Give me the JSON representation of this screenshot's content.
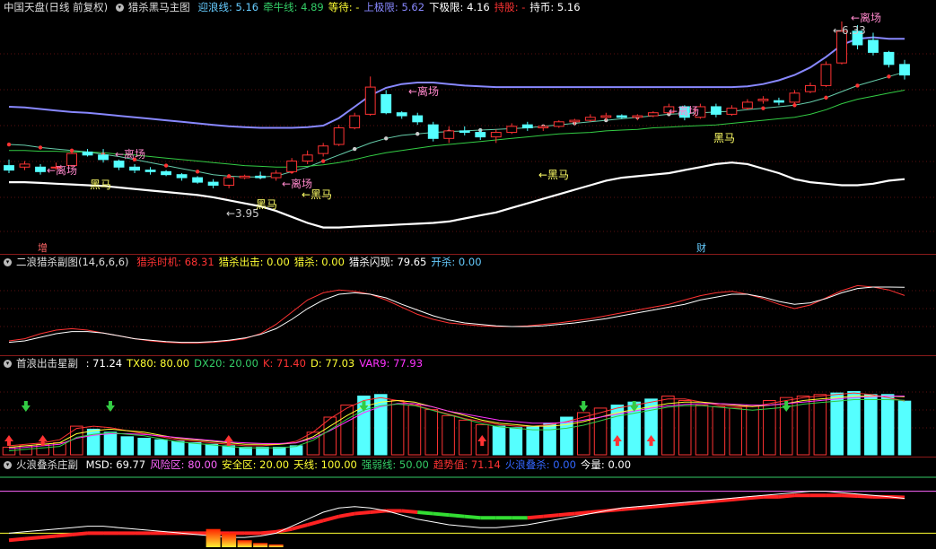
{
  "main_header": {
    "stock": "中国天盘",
    "mode": "(日线 前复权)",
    "indicator": "猎杀黑马主图",
    "items": [
      {
        "label": "迎浪线:",
        "value": "5.16",
        "color": "#66ccff"
      },
      {
        "label": "牵牛线:",
        "value": "4.89",
        "color": "#33cc66"
      },
      {
        "label": "等待:",
        "value": "-",
        "color": "#ffff33"
      },
      {
        "label": "上极限:",
        "value": "5.62",
        "color": "#8888ff"
      },
      {
        "label": "下极限:",
        "value": "4.16",
        "color": "#ffffff"
      },
      {
        "label": "持股:",
        "value": "-",
        "color": "#ff3333"
      },
      {
        "label": "持币:",
        "value": "5.16",
        "color": "#ffffff"
      }
    ]
  },
  "main_annotations": {
    "exit_label": "←离场",
    "dark_horse_label": "黑马",
    "dark_horse_arrow_label": "←黑马",
    "low_price_label": "←3.95",
    "high_price_label": "←6.33",
    "bottom_left_label": "增",
    "bottom_mid_label": "财"
  },
  "panel2_header": {
    "title": "二浪猎杀副图(14,6,6,6)",
    "items": [
      {
        "label": "猎杀时机:",
        "value": "68.31",
        "color": "#ff3333"
      },
      {
        "label": "猎杀出击:",
        "value": "0.00",
        "color": "#ffff33"
      },
      {
        "label": "猎杀:",
        "value": "0.00",
        "color": "#ffff33"
      },
      {
        "label": "猎杀闪现:",
        "value": "79.65",
        "color": "#ffffff"
      },
      {
        "label": "开杀:",
        "value": "0.00",
        "color": "#66ccff"
      }
    ]
  },
  "panel3_header": {
    "title": "首浪出击星副",
    "items": [
      {
        "label": ":",
        "value": "71.24",
        "color": "#ffffff"
      },
      {
        "label": "TX80:",
        "value": "80.00",
        "color": "#ffff33"
      },
      {
        "label": "DX20:",
        "value": "20.00",
        "color": "#33cc66"
      },
      {
        "label": "K:",
        "value": "71.40",
        "color": "#ff3333"
      },
      {
        "label": "D:",
        "value": "77.03",
        "color": "#ffff33"
      },
      {
        "label": "VAR9:",
        "value": "77.93",
        "color": "#ff33ff"
      }
    ]
  },
  "panel4_header": {
    "title": "火浪叠杀庄副",
    "items": [
      {
        "label": "MSD:",
        "value": "69.77",
        "color": "#ffffff"
      },
      {
        "label": "风险区:",
        "value": "80.00",
        "color": "#ff66ff"
      },
      {
        "label": "安全区:",
        "value": "20.00",
        "color": "#ffff33"
      },
      {
        "label": "天线:",
        "value": "100.00",
        "color": "#ffff33"
      },
      {
        "label": "强弱线:",
        "value": "50.00",
        "color": "#33cc66"
      },
      {
        "label": "趋势值:",
        "value": "71.14",
        "color": "#ff3333"
      },
      {
        "label": "火浪叠杀:",
        "value": "0.00",
        "color": "#3366ff"
      },
      {
        "label": "今量:",
        "value": "0.00",
        "color": "#ffffff"
      }
    ]
  },
  "chart_data": [
    {
      "type": "candlestick",
      "note_series": [
        "迎浪线",
        "牵牛线",
        "上极限",
        "下极限"
      ],
      "ohlc": [
        [
          4.42,
          4.5,
          4.32,
          4.36
        ],
        [
          4.4,
          4.48,
          4.36,
          4.44
        ],
        [
          4.4,
          4.44,
          4.3,
          4.34
        ],
        [
          4.4,
          4.46,
          4.36,
          4.4
        ],
        [
          4.42,
          4.62,
          4.4,
          4.58
        ],
        [
          4.6,
          4.64,
          4.54,
          4.56
        ],
        [
          4.56,
          4.64,
          4.46,
          4.5
        ],
        [
          4.48,
          4.5,
          4.36,
          4.4
        ],
        [
          4.4,
          4.44,
          4.32,
          4.36
        ],
        [
          4.36,
          4.4,
          4.3,
          4.34
        ],
        [
          4.34,
          4.36,
          4.28,
          4.3
        ],
        [
          4.3,
          4.32,
          4.22,
          4.26
        ],
        [
          4.26,
          4.28,
          4.18,
          4.2
        ],
        [
          4.2,
          4.24,
          4.12,
          4.16
        ],
        [
          4.16,
          4.3,
          4.12,
          4.26
        ],
        [
          4.26,
          4.3,
          4.24,
          4.28
        ],
        [
          4.28,
          4.34,
          4.24,
          4.26
        ],
        [
          4.26,
          4.36,
          4.22,
          4.32
        ],
        [
          4.34,
          4.52,
          4.32,
          4.48
        ],
        [
          4.48,
          4.62,
          4.44,
          4.56
        ],
        [
          4.58,
          4.72,
          4.54,
          4.68
        ],
        [
          4.7,
          4.96,
          4.68,
          4.92
        ],
        [
          4.92,
          5.12,
          4.9,
          5.08
        ],
        [
          5.1,
          5.6,
          5.08,
          5.46
        ],
        [
          5.36,
          5.42,
          5.1,
          5.12
        ],
        [
          5.12,
          5.14,
          5.04,
          5.08
        ],
        [
          5.08,
          5.12,
          4.96,
          5.0
        ],
        [
          4.96,
          5.0,
          4.74,
          4.78
        ],
        [
          4.78,
          4.94,
          4.72,
          4.88
        ],
        [
          4.88,
          4.94,
          4.82,
          4.86
        ],
        [
          4.86,
          4.9,
          4.76,
          4.8
        ],
        [
          4.8,
          4.9,
          4.72,
          4.86
        ],
        [
          4.86,
          4.98,
          4.84,
          4.94
        ],
        [
          4.96,
          5.0,
          4.88,
          4.92
        ],
        [
          4.92,
          4.96,
          4.88,
          4.94
        ],
        [
          4.94,
          5.02,
          4.92,
          5.0
        ],
        [
          5.0,
          5.04,
          4.96,
          5.02
        ],
        [
          5.02,
          5.1,
          5.0,
          5.06
        ],
        [
          5.06,
          5.12,
          5.02,
          5.08
        ],
        [
          5.08,
          5.1,
          5.04,
          5.06
        ],
        [
          5.06,
          5.1,
          5.02,
          5.08
        ],
        [
          5.08,
          5.14,
          5.06,
          5.12
        ],
        [
          5.12,
          5.24,
          5.1,
          5.2
        ],
        [
          5.2,
          5.22,
          5.02,
          5.06
        ],
        [
          5.06,
          5.24,
          5.04,
          5.2
        ],
        [
          5.2,
          5.24,
          5.06,
          5.1
        ],
        [
          5.1,
          5.22,
          5.08,
          5.18
        ],
        [
          5.18,
          5.3,
          5.16,
          5.26
        ],
        [
          5.28,
          5.34,
          5.24,
          5.3
        ],
        [
          5.28,
          5.32,
          5.22,
          5.26
        ],
        [
          5.26,
          5.42,
          5.24,
          5.38
        ],
        [
          5.4,
          5.52,
          5.38,
          5.48
        ],
        [
          5.48,
          5.8,
          5.46,
          5.76
        ],
        [
          5.78,
          6.33,
          5.76,
          6.2
        ],
        [
          6.2,
          6.28,
          5.96,
          6.02
        ],
        [
          6.08,
          6.18,
          5.88,
          5.92
        ],
        [
          5.92,
          5.94,
          5.72,
          5.76
        ],
        [
          5.76,
          5.82,
          5.56,
          5.62
        ]
      ],
      "lines": {
        "迎浪线": [
          4.7,
          4.69,
          4.66,
          4.64,
          4.62,
          4.6,
          4.57,
          4.54,
          4.5,
          4.46,
          4.42,
          4.38,
          4.34,
          4.3,
          4.28,
          4.27,
          4.27,
          4.28,
          4.34,
          4.4,
          4.48,
          4.56,
          4.64,
          4.72,
          4.78,
          4.82,
          4.84,
          4.86,
          4.87,
          4.88,
          4.89,
          4.9,
          4.91,
          4.92,
          4.94,
          4.96,
          4.98,
          5.0,
          5.02,
          5.04,
          5.06,
          5.08,
          5.1,
          5.11,
          5.12,
          5.13,
          5.14,
          5.16,
          5.18,
          5.2,
          5.22,
          5.26,
          5.32,
          5.4,
          5.48,
          5.54,
          5.6,
          5.66
        ],
        "牵牛线": [
          4.62,
          4.62,
          4.61,
          4.61,
          4.6,
          4.6,
          4.59,
          4.57,
          4.56,
          4.54,
          4.52,
          4.5,
          4.48,
          4.46,
          4.44,
          4.42,
          4.41,
          4.4,
          4.4,
          4.41,
          4.43,
          4.46,
          4.5,
          4.55,
          4.59,
          4.62,
          4.65,
          4.68,
          4.7,
          4.72,
          4.74,
          4.76,
          4.78,
          4.8,
          4.82,
          4.84,
          4.85,
          4.86,
          4.88,
          4.89,
          4.9,
          4.92,
          4.93,
          4.94,
          4.95,
          4.96,
          4.98,
          5.0,
          5.02,
          5.04,
          5.06,
          5.1,
          5.16,
          5.24,
          5.3,
          5.34,
          5.38,
          5.42
        ],
        "上极限": [
          5.2,
          5.19,
          5.17,
          5.15,
          5.13,
          5.12,
          5.1,
          5.08,
          5.06,
          5.04,
          5.02,
          5.0,
          4.98,
          4.96,
          4.94,
          4.93,
          4.92,
          4.92,
          4.92,
          4.93,
          4.95,
          5.05,
          5.2,
          5.35,
          5.45,
          5.5,
          5.52,
          5.52,
          5.5,
          5.48,
          5.47,
          5.46,
          5.46,
          5.46,
          5.46,
          5.46,
          5.46,
          5.46,
          5.46,
          5.46,
          5.46,
          5.46,
          5.46,
          5.46,
          5.46,
          5.46,
          5.46,
          5.47,
          5.5,
          5.55,
          5.62,
          5.72,
          5.86,
          6.02,
          6.1,
          6.12,
          6.1,
          6.1
        ],
        "下极限": [
          4.2,
          4.2,
          4.19,
          4.18,
          4.17,
          4.16,
          4.15,
          4.13,
          4.11,
          4.09,
          4.07,
          4.05,
          4.03,
          4.0,
          3.96,
          3.92,
          3.88,
          3.82,
          3.74,
          3.66,
          3.6,
          3.6,
          3.61,
          3.62,
          3.63,
          3.64,
          3.65,
          3.66,
          3.68,
          3.72,
          3.76,
          3.8,
          3.86,
          3.92,
          3.98,
          4.04,
          4.1,
          4.16,
          4.22,
          4.26,
          4.28,
          4.3,
          4.32,
          4.36,
          4.4,
          4.44,
          4.46,
          4.44,
          4.38,
          4.32,
          4.24,
          4.2,
          4.18,
          4.16,
          4.16,
          4.18,
          4.22,
          4.24
        ]
      }
    },
    {
      "type": "line",
      "series": [
        {
          "name": "猎杀时机",
          "values": [
            5,
            8,
            15,
            20,
            22,
            20,
            16,
            12,
            8,
            5,
            3,
            2,
            2,
            3,
            5,
            8,
            15,
            28,
            45,
            62,
            72,
            76,
            74,
            70,
            62,
            52,
            42,
            35,
            30,
            28,
            26,
            25,
            25,
            26,
            28,
            30,
            33,
            36,
            40,
            44,
            48,
            52,
            56,
            62,
            68,
            72,
            74,
            70,
            64,
            56,
            50,
            55,
            65,
            75,
            82,
            80,
            76,
            68.31
          ]
        },
        {
          "name": "猎杀闪现",
          "values": [
            3,
            5,
            10,
            15,
            18,
            18,
            16,
            12,
            8,
            6,
            4,
            3,
            3,
            4,
            6,
            9,
            14,
            22,
            35,
            50,
            62,
            70,
            72,
            70,
            65,
            56,
            48,
            40,
            34,
            30,
            28,
            26,
            25,
            25,
            26,
            28,
            30,
            33,
            36,
            40,
            44,
            48,
            52,
            56,
            62,
            66,
            70,
            70,
            66,
            60,
            56,
            58,
            64,
            72,
            78,
            80,
            80,
            79.65
          ]
        }
      ],
      "ylim": [
        0,
        100
      ]
    },
    {
      "type": "bar",
      "values": [
        10,
        12,
        14,
        16,
        38,
        34,
        30,
        24,
        22,
        20,
        18,
        16,
        14,
        12,
        10,
        10,
        10,
        12,
        30,
        50,
        66,
        78,
        80,
        72,
        66,
        60,
        52,
        46,
        40,
        38,
        36,
        38,
        42,
        50,
        56,
        62,
        66,
        70,
        74,
        78,
        72,
        66,
        64,
        62,
        66,
        72,
        76,
        78,
        80,
        82,
        84,
        80,
        80,
        71.24
      ],
      "series": [
        {
          "name": "K",
          "values": [
            12,
            14,
            16,
            20,
            35,
            38,
            36,
            32,
            28,
            24,
            20,
            18,
            16,
            14,
            12,
            12,
            14,
            18,
            30,
            48,
            62,
            72,
            76,
            72,
            66,
            60,
            54,
            48,
            44,
            40,
            38,
            38,
            40,
            44,
            50,
            56,
            62,
            66,
            70,
            74,
            74,
            70,
            66,
            64,
            64,
            68,
            72,
            76,
            78,
            80,
            82,
            80,
            76,
            71.4
          ]
        },
        {
          "name": "D",
          "values": [
            10,
            12,
            14,
            16,
            28,
            32,
            34,
            32,
            30,
            26,
            22,
            20,
            18,
            16,
            14,
            14,
            14,
            16,
            24,
            38,
            52,
            64,
            70,
            72,
            70,
            64,
            58,
            52,
            46,
            42,
            40,
            38,
            38,
            40,
            44,
            50,
            56,
            60,
            64,
            68,
            70,
            70,
            68,
            66,
            64,
            66,
            68,
            72,
            74,
            76,
            78,
            78,
            78,
            77.03
          ]
        },
        {
          "name": "VAR9",
          "values": [
            8,
            10,
            12,
            14,
            22,
            26,
            28,
            28,
            27,
            25,
            23,
            21,
            19,
            17,
            16,
            15,
            15,
            16,
            22,
            32,
            44,
            56,
            64,
            68,
            68,
            64,
            58,
            54,
            50,
            46,
            44,
            42,
            42,
            43,
            46,
            50,
            54,
            58,
            62,
            65,
            67,
            68,
            68,
            67,
            66,
            66,
            68,
            70,
            72,
            74,
            76,
            77,
            78,
            77.93
          ]
        }
      ],
      "ylim": [
        0,
        100
      ]
    },
    {
      "type": "area",
      "series": [
        {
          "name": "MSD",
          "values": [
            20,
            22,
            24,
            26,
            28,
            30,
            30,
            28,
            26,
            24,
            22,
            20,
            18,
            16,
            14,
            14,
            16,
            20,
            30,
            40,
            50,
            56,
            58,
            56,
            52,
            46,
            40,
            36,
            32,
            30,
            28,
            28,
            30,
            32,
            36,
            40,
            44,
            48,
            52,
            56,
            58,
            60,
            62,
            64,
            66,
            68,
            70,
            72,
            74,
            76,
            78,
            80,
            80,
            78,
            76,
            74,
            72,
            69.77
          ]
        },
        {
          "name": "趋势值",
          "values": [
            10,
            12,
            14,
            16,
            18,
            20,
            20,
            20,
            20,
            20,
            20,
            20,
            20,
            20,
            20,
            20,
            20,
            22,
            26,
            32,
            38,
            44,
            48,
            50,
            52,
            52,
            50,
            48,
            46,
            44,
            42,
            42,
            42,
            42,
            44,
            46,
            48,
            50,
            52,
            54,
            56,
            58,
            60,
            62,
            64,
            66,
            68,
            70,
            72,
            72,
            74,
            74,
            74,
            74,
            73,
            72,
            72,
            71.14
          ]
        }
      ],
      "ylim": [
        0,
        100
      ]
    }
  ]
}
